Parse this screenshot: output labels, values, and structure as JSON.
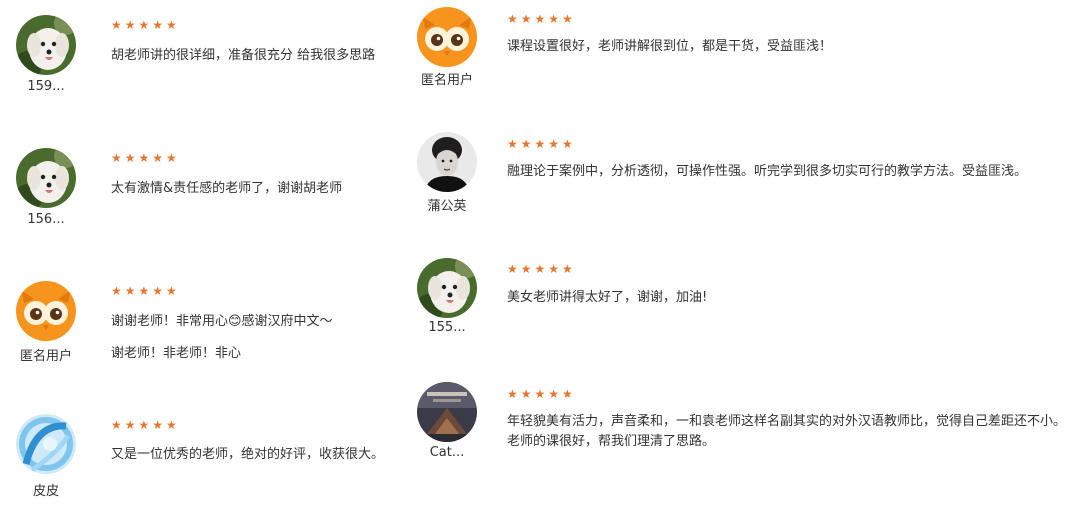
{
  "colors": {
    "star": "#e8772e",
    "text": "#333333",
    "background": "#ffffff"
  },
  "rating_symbol": "★★★★★",
  "reviews": [
    {
      "username": "159...",
      "avatar_icon": "puppy-avatar-icon",
      "rating": 5,
      "lines": [
        "胡老师讲的很详细，准备很充分 给我很多思路"
      ]
    },
    {
      "username": "156...",
      "avatar_icon": "puppy-avatar-icon",
      "rating": 5,
      "lines": [
        "太有激情&责任感的老师了，谢谢胡老师"
      ]
    },
    {
      "username": "匿名用户",
      "avatar_icon": "owl-avatar-icon",
      "rating": 5,
      "lines": [
        "谢谢老师！非常用心😊感谢汉府中文～",
        "谢老师！非老师！非心"
      ]
    },
    {
      "username": "皮皮",
      "avatar_icon": "blue-swirl-avatar-icon",
      "rating": 5,
      "lines": [
        "又是一位优秀的老师，绝对的好评，收获很大。"
      ]
    },
    {
      "username": "匿名用户",
      "avatar_icon": "owl-avatar-icon",
      "rating": 5,
      "lines": [
        "课程设置很好，老师讲解很到位，都是干货，受益匪浅！"
      ]
    },
    {
      "username": "蒲公英",
      "avatar_icon": "portrait-avatar-icon",
      "rating": 5,
      "lines": [
        "融理论于案例中，分析透彻，可操作性强。听完学到很多切实可行的教学方法。受益匪浅。"
      ]
    },
    {
      "username": "155...",
      "avatar_icon": "puppy-avatar-icon",
      "rating": 5,
      "lines": [
        "美女老师讲得太好了，谢谢，加油!"
      ]
    },
    {
      "username": "Cat...",
      "avatar_icon": "book-cover-avatar-icon",
      "rating": 5,
      "lines": [
        "年轻貌美有活力，声音柔和，一和袁老师这样名副其实的对外汉语教师比，觉得自己差距还不小。",
        "老师的课很好，帮我们理清了思路。"
      ]
    }
  ]
}
